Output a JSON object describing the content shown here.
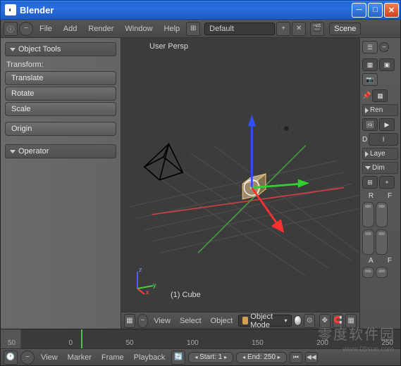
{
  "window": {
    "title": "Blender"
  },
  "menubar": {
    "items": [
      "File",
      "Add",
      "Render",
      "Window",
      "Help"
    ],
    "layout_dropdown": "Default",
    "scene_label": "Scene"
  },
  "tool_panel": {
    "header": "Object Tools",
    "transform_label": "Transform:",
    "buttons": {
      "translate": "Translate",
      "rotate": "Rotate",
      "scale": "Scale",
      "origin": "Origin"
    },
    "operator_header": "Operator"
  },
  "viewport": {
    "persp_label": "User Persp",
    "object_label": "(1) Cube",
    "axis_x": "x",
    "axis_y": "y",
    "axis_z": "z"
  },
  "viewport_header": {
    "view": "View",
    "select": "Select",
    "object": "Object",
    "mode": "Object Mode"
  },
  "props": {
    "ren": "Ren",
    "d": "D",
    "laye": "Laye",
    "dim": "Dim",
    "r": "R",
    "f": "F",
    "a": "A"
  },
  "timeline": {
    "labels": [
      "50",
      "0",
      "50",
      "100",
      "150",
      "200",
      "250"
    ]
  },
  "bottombar": {
    "view": "View",
    "marker": "Marker",
    "frame": "Frame",
    "playback": "Playback",
    "start": "Start: 1",
    "end": "End: 250"
  },
  "watermark": {
    "main": "零度软件园",
    "sub": "www.05sun.com"
  }
}
